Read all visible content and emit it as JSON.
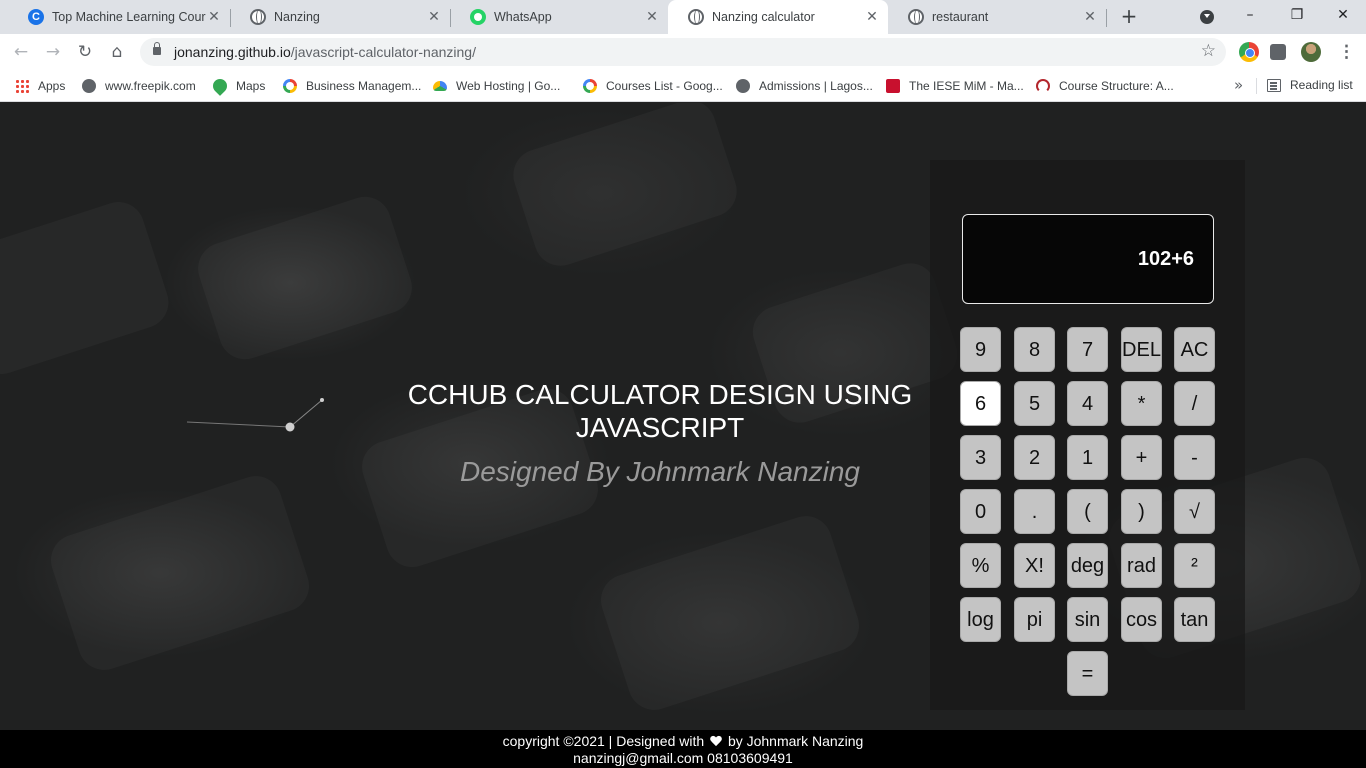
{
  "browser": {
    "tabs": [
      {
        "title": "Top Machine Learning Course",
        "icon": "coursera-icon",
        "active": false
      },
      {
        "title": "Nanzing",
        "icon": "globe-icon",
        "active": false
      },
      {
        "title": "WhatsApp",
        "icon": "whatsapp-icon",
        "active": false
      },
      {
        "title": "Nanzing calculator",
        "icon": "globe-icon",
        "active": true
      },
      {
        "title": "restaurant",
        "icon": "globe-icon",
        "active": false
      }
    ],
    "url_host": "jonanzing.github.io",
    "url_path": "/javascript-calculator-nanzing/",
    "bookmarks": [
      {
        "label": "Apps",
        "icon": "apps-grid-icon"
      },
      {
        "label": "www.freepik.com",
        "icon": "globe-icon"
      },
      {
        "label": "Maps",
        "icon": "maps-pin-icon"
      },
      {
        "label": "Business Managem...",
        "icon": "google-icon"
      },
      {
        "label": "Web Hosting | Go...",
        "icon": "google-cloud-icon"
      },
      {
        "label": "Courses List - Goog...",
        "icon": "google-icon"
      },
      {
        "label": "Admissions | Lagos...",
        "icon": "globe-icon"
      },
      {
        "label": "The IESE MiM - Ma...",
        "icon": "iese-icon"
      },
      {
        "label": "Course Structure: A...",
        "icon": "course-icon"
      }
    ],
    "bookmarks_more": "»",
    "reading_list": "Reading list"
  },
  "hero": {
    "title": "CCHUB CALCULATOR DESIGN USING JAVASCRIPT",
    "subtitle": "Designed By Johnmark Nanzing"
  },
  "calculator": {
    "display": "102+6",
    "keys": [
      [
        "9",
        "8",
        "7",
        "DEL",
        "AC"
      ],
      [
        "6",
        "5",
        "4",
        "*",
        "/"
      ],
      [
        "3",
        "2",
        "1",
        "+",
        "-"
      ],
      [
        "0",
        ".",
        "(",
        ")",
        "√"
      ],
      [
        "%",
        "X!",
        "deg",
        "rad",
        "²"
      ],
      [
        "log",
        "pi",
        "sin",
        "cos",
        "tan"
      ],
      [
        "",
        "",
        "=",
        "",
        ""
      ]
    ],
    "highlighted_key": "6"
  },
  "footer": {
    "line1_prefix": "copyright ©2021 | Designed with",
    "line1_suffix": "by Johnmark Nanzing",
    "line2": "nanzingj@gmail.com 08103609491"
  }
}
